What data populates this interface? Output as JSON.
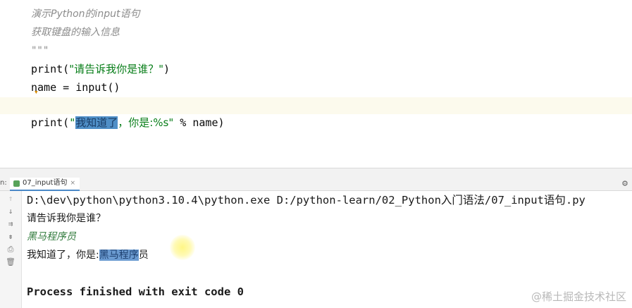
{
  "editor": {
    "doc_lines": [
      "演示Python的input语句",
      "获取键盘的输入信息",
      "\"\"\""
    ],
    "line4": {
      "fn": "print(",
      "str": "\"请告诉我你是谁？\"",
      "close": ")"
    },
    "line5": "name = input()",
    "line6": {
      "fn": "print(",
      "q": "\"",
      "hl": "我知道了",
      "str_rest": "，你是:%s\"",
      "tail": " % name)"
    }
  },
  "run_panel": {
    "label": "n:",
    "tab_label": "07_input语句",
    "tab_close": "×",
    "gear_icon": "⚙",
    "tools": [
      "↑",
      "↓",
      "⇉",
      "⇟",
      "⎙",
      "🗑"
    ]
  },
  "console": {
    "command": "D:\\dev\\python\\python3.10.4\\python.exe D:/python-learn/02_Python入门语法/07_input语句.py",
    "prompt": "请告诉我你是谁？",
    "user_input": "黑马程序员",
    "output_prefix": "我知道了，你是:",
    "output_hl": "黑马程序",
    "output_rest": "员",
    "exit_message": "Process finished with exit code 0"
  },
  "watermark": "@稀土掘金技术社区"
}
